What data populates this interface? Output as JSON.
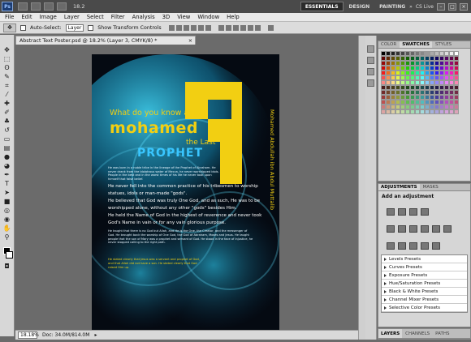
{
  "app": {
    "logo": "Ps",
    "zoom_select": "18.2",
    "workspaces": [
      "ESSENTIALS",
      "DESIGN",
      "PAINTING"
    ],
    "active_workspace": "ESSENTIALS",
    "cs_live": "CS Live"
  },
  "menu": [
    "File",
    "Edit",
    "Image",
    "Layer",
    "Select",
    "Filter",
    "Analysis",
    "3D",
    "View",
    "Window",
    "Help"
  ],
  "options": {
    "auto_select": "Auto-Select:",
    "auto_select_value": "Layer",
    "transform": "Show Transform Controls"
  },
  "document": {
    "tab_title": "Abstract Text Poster.psd @ 18.2% (Layer 3, CMYK/8) *",
    "close": "×",
    "zoom": "18.18%",
    "doc_size": "Doc: 34.0M/814.0M"
  },
  "poster": {
    "heading": "What do you know about",
    "name": "mohamed",
    "the_last": "the Last",
    "prophet": "PROPHET",
    "side_name": "Mohamed Abdullah ibn Abdul Muttalib",
    "para_small_1": "He was born in a noble tribe in the lineage of the Prophet of Abraham. He never drank from the idolatrous water of Mecca, he never worshipped idols. People in the best and in the worst times of his life he never took upon himself that false belief.",
    "para_big": [
      "He never fell into the common practice of his tribesmen to worship",
      "statues, idols or man-made \"gods\".",
      "He believed that God was truly One God, and as such, He was to be",
      "worshipped alone, without any other \"gods\" besides Him.",
      "He held the Name of God in the highest of reverence and never took",
      "God's Name in vain or for any vain glorious purpose."
    ],
    "para_small_2": "He taught that there is no God but Allah, and He is the One, the Creator, and the messenger of God. He brought back the worship of One God, the God of Abraham, Moses and Jesus. He taught people that the son of Mary was a prophet and servant of God. He stood in the face of injustice, he never stopped calling to the right path.",
    "para_gold": "He stated clearly that Jesus was a servant and prophet of God, and that Allah did not have a son. He stated clearly that God raised Him up."
  },
  "panels": {
    "color_tabs": [
      "COLOR",
      "SWATCHES",
      "STYLES"
    ],
    "color_active": "SWATCHES",
    "adj_tabs": [
      "ADJUSTMENTS",
      "MASKS"
    ],
    "adj_active": "ADJUSTMENTS",
    "adj_title": "Add an adjustment",
    "presets": [
      "Levels Presets",
      "Curves Presets",
      "Exposure Presets",
      "Hue/Saturation Presets",
      "Black & White Presets",
      "Channel Mixer Presets",
      "Selective Color Presets"
    ],
    "layer_tabs": [
      "LAYERS",
      "CHANNELS",
      "PATHS"
    ],
    "layer_active": "LAYERS"
  },
  "colors": {
    "accent_yellow": "#f2cf12",
    "accent_cyan": "#27b4d8",
    "poster_bg": "#050a12"
  }
}
